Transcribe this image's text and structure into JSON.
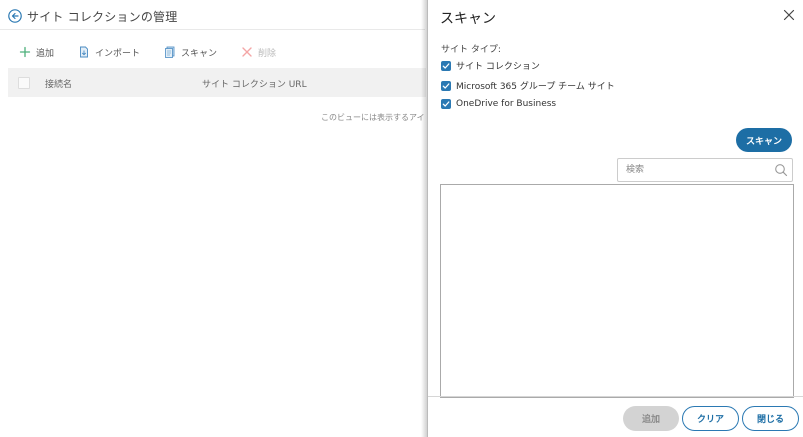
{
  "background": {
    "title": "サイト コレクションの管理",
    "toolbar": {
      "add_label": "追加",
      "import_label": "インポート",
      "scan_label": "スキャン",
      "delete_label": "削除"
    },
    "grid": {
      "columns": [
        "接続名",
        "サイト コレクション URL"
      ],
      "empty_message": "このビューには表示するアイテム"
    }
  },
  "dialog": {
    "title": "スキャン",
    "site_type_label": "サイト タイプ:",
    "site_types": [
      {
        "label": "サイト コレクション",
        "checked": true
      },
      {
        "label": "Microsoft 365 グループ チーム サイト",
        "checked": true
      },
      {
        "label": "OneDrive for Business",
        "checked": true
      }
    ],
    "scan_button": "スキャン",
    "search_placeholder": "検索",
    "footer": {
      "add_label": "追加",
      "clear_label": "クリア",
      "close_label": "閉じる"
    }
  },
  "colors": {
    "accent": "#1d6ea5",
    "checkbox": "#2b79b3",
    "disabled_button": "#d3d3d3",
    "delete_icon": "#f4a6a6"
  },
  "icons": [
    "back-arrow-icon",
    "plus-icon",
    "import-icon",
    "scan-icon",
    "delete-x-icon",
    "close-icon",
    "search-icon",
    "checkmark-icon"
  ]
}
